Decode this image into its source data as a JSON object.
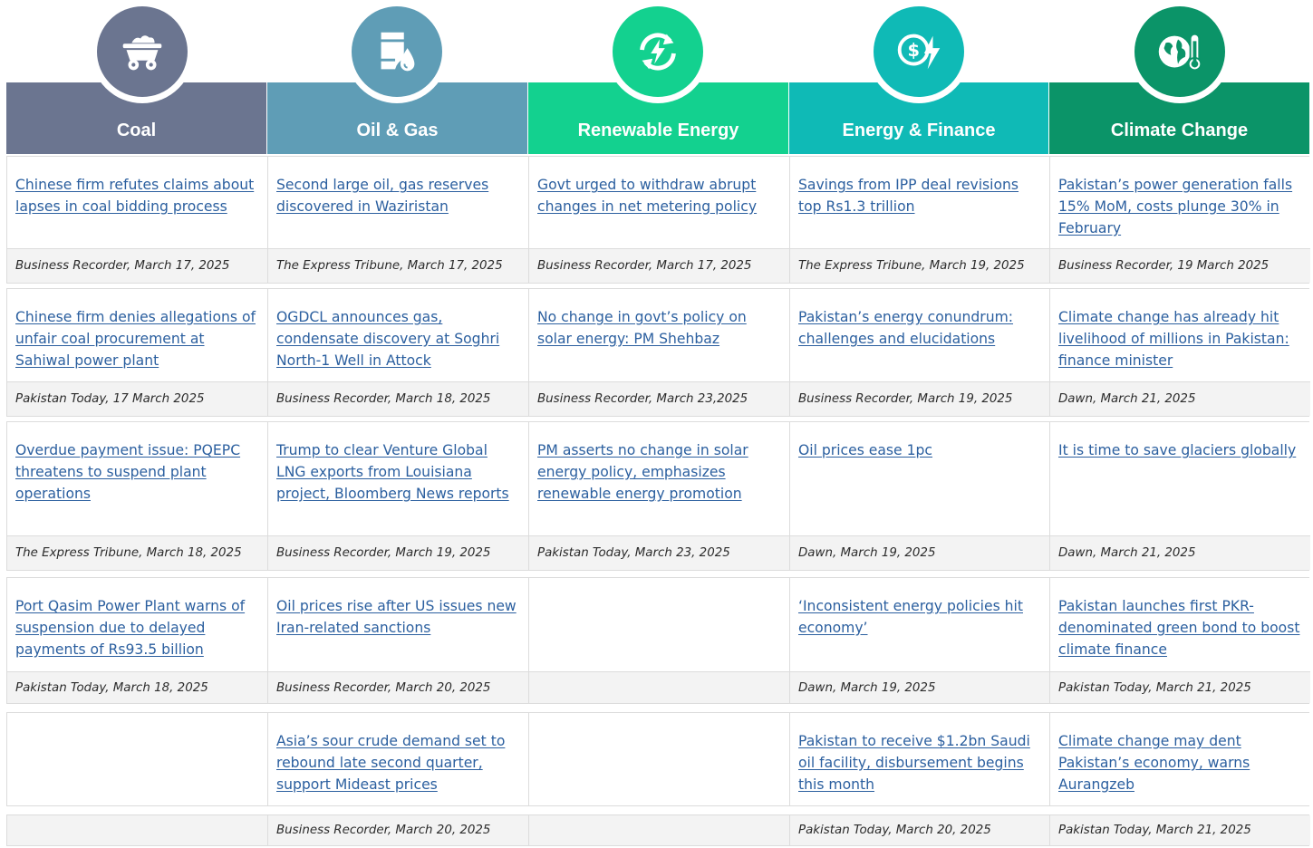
{
  "colors": {
    "coal": "#6b7590",
    "oil_gas": "#5f9db6",
    "renewable": "#13d18f",
    "finance": "#0fbab6",
    "climate": "#0b9468",
    "link": "#2b5f9f"
  },
  "columns": [
    {
      "key": "coal",
      "label": "Coal",
      "icon": "coal-cart-icon"
    },
    {
      "key": "oil_gas",
      "label": "Oil & Gas",
      "icon": "oil-barrel-drop-icon"
    },
    {
      "key": "renewable",
      "label": "Renewable Energy",
      "icon": "renewable-cycle-bolt-icon"
    },
    {
      "key": "finance",
      "label": "Energy & Finance",
      "icon": "dollar-bolt-icon"
    },
    {
      "key": "climate",
      "label": "Climate Change",
      "icon": "globe-thermometer-icon"
    }
  ],
  "rows": [
    {
      "cells": [
        {
          "title": "Chinese firm refutes claims about lapses in coal bidding process",
          "source": "Business Recorder, March 17, 2025"
        },
        {
          "title": "Second large oil, gas reserves discovered in Waziristan",
          "source": "The Express Tribune, March 17, 2025"
        },
        {
          "title": "Govt urged to withdraw abrupt changes in net metering policy",
          "source": "Business Recorder, March 17, 2025"
        },
        {
          "title": "Savings from IPP deal revisions top Rs1.3 trillion",
          "source": "The Express Tribune, March 19, 2025"
        },
        {
          "title": "Pakistan’s power generation falls 15% MoM, costs plunge 30% in February",
          "source": "Business Recorder, 19 March 2025"
        }
      ]
    },
    {
      "cells": [
        {
          "title": "Chinese firm denies allegations of unfair coal procurement at Sahiwal power plant",
          "source": "Pakistan Today, 17 March 2025"
        },
        {
          "title": "OGDCL announces gas, condensate discovery at Soghri North-1 Well in Attock",
          "source": "Business Recorder, March 18, 2025"
        },
        {
          "title": "No change in govt’s policy on solar energy: PM Shehbaz",
          "source": "Business Recorder, March 23,2025"
        },
        {
          "title": "Pakistan’s energy conundrum: challenges and elucidations",
          "source": "Business Recorder, March 19, 2025"
        },
        {
          "title": "Climate change has already hit livelihood of millions in Pakistan: finance minister",
          "source": "Dawn, March 21, 2025"
        }
      ]
    },
    {
      "cells": [
        {
          "title": "Overdue payment issue: PQEPC threatens to suspend plant operations",
          "source": "The Express Tribune, March 18, 2025"
        },
        {
          "title": "Trump to clear Venture Global LNG exports from Louisiana project, Bloomberg News reports",
          "source": "Business Recorder, March 19, 2025"
        },
        {
          "title": "PM asserts no change in solar energy policy, emphasizes renewable energy promotion",
          "source": "Pakistan Today, March 23, 2025"
        },
        {
          "title": "Oil prices ease 1pc",
          "source": "Dawn, March 19, 2025"
        },
        {
          "title": "It is time to save glaciers globally",
          "source": "Dawn, March 21, 2025"
        }
      ]
    },
    {
      "cells": [
        {
          "title": "Port Qasim Power Plant warns of suspension due to delayed payments of Rs93.5 billion",
          "source": "Pakistan Today, March 18, 2025"
        },
        {
          "title": "Oil prices rise after US issues new Iran-related sanctions",
          "source": "Business Recorder, March 20, 2025"
        },
        {
          "title": "",
          "source": ""
        },
        {
          "title": "‘Inconsistent energy policies hit economy’",
          "source": "Dawn, March 19, 2025"
        },
        {
          "title": "Pakistan launches first PKR-denominated green bond to boost climate finance",
          "source": "Pakistan Today, March 21, 2025"
        }
      ]
    },
    {
      "cells": [
        {
          "title": "",
          "source": ""
        },
        {
          "title": "Asia’s sour crude demand set to rebound late second quarter, support Mideast prices",
          "source": "Business Recorder, March 20, 2025"
        },
        {
          "title": "",
          "source": ""
        },
        {
          "title": "Pakistan to receive $1.2bn Saudi oil facility, disbursement begins this month",
          "source": "Pakistan Today, March 20, 2025"
        },
        {
          "title": "Climate change may dent Pakistan’s economy, warns Aurangzeb",
          "source": "Pakistan Today, March 21, 2025"
        }
      ]
    }
  ]
}
